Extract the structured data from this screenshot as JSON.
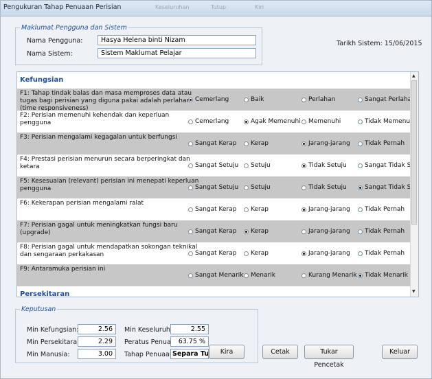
{
  "window": {
    "title": "Pengukuran Tahap Penuaan Perisian",
    "ghost_tabs": [
      "Keseluruhan",
      "Tutup",
      "Kiri"
    ]
  },
  "user_group": {
    "legend": "Maklumat Pengguna dan Sistem",
    "user_label": "Nama Pengguna:",
    "user_value": "Hasya Helena binti Nizam",
    "system_label": "Nama Sistem:",
    "system_value": "Sistem Maklumat Pelajar",
    "date_text": "Tarikh Sistem: 15/06/2015"
  },
  "panel": {
    "section1": "Kefungsian",
    "section2": "Persekitaran",
    "rows": [
      {
        "q": "F1: Tahap tindak balas dan masa memproses data atau tugas  bagi perisian yang diguna pakai adalah perlahan (time responsiveness)",
        "shade": true,
        "options": [
          "Cemerlang",
          "Baik",
          "Perlahan",
          "Sangat Perlahan"
        ],
        "selected": 0
      },
      {
        "q": "F2: Perisian  memenuhi kehendak dan keperluan pengguna",
        "shade": false,
        "options": [
          "Cemerlang",
          "Agak Memenuhi",
          "Memenuhi",
          "Tidak Memenuhi"
        ],
        "selected": 1
      },
      {
        "q": "F3: Perisian  mengalami kegagalan untuk berfungsi",
        "shade": true,
        "options": [
          "Sangat Kerap",
          "Kerap",
          "Jarang-jarang",
          "Tidak Pernah"
        ],
        "selected": 2
      },
      {
        "q": "F4: Prestasi perisian menurun secara berperingkat dan ketara",
        "shade": false,
        "options": [
          "Sangat Setuju",
          "Setuju",
          "Tidak Setuju",
          "Sangat Tidak Setuju"
        ],
        "selected": 2
      },
      {
        "q": "F5: Kesesuaian (relevant) perisian ini menepati keperluan pengguna",
        "shade": true,
        "options": [
          "Sangat Setuju",
          "Setuju",
          "Tidak Setuju",
          "Sangat Tidak Setuju"
        ],
        "selected": 3
      },
      {
        "q": "F6: Kekerapan perisian mengalami ralat",
        "shade": false,
        "options": [
          "Sangat Kerap",
          "Kerap",
          "Jarang-jarang",
          "Tidak Pernah"
        ],
        "selected": 2
      },
      {
        "q": "F7: Perisian gagal untuk meningkatkan fungsi baru (upgrade)",
        "shade": true,
        "options": [
          "Sangat Kerap",
          "Kerap",
          "Jarang-jarang",
          "Tidak Pernah"
        ],
        "selected": 1
      },
      {
        "q": "F8: Perisian gagal untuk mendapatkan sokongan teknikal dan sengaraan perkakasan",
        "shade": false,
        "options": [
          "Sangat Kerap",
          "Kerap",
          "Jarang-jarang",
          "Tidak Pernah"
        ],
        "selected": 2
      },
      {
        "q": "F9: Antaramuka perisian ini",
        "shade": true,
        "options": [
          "Sangat Menarik",
          "Menarik",
          "Kurang Menarik",
          "Tidak Menarik"
        ],
        "selected": 3
      }
    ]
  },
  "decision": {
    "legend": "Keputusan",
    "func_label": "Min Kefungsian:",
    "func_value": "2.56",
    "env_label": "Min Persekitaran:",
    "env_value": "2.29",
    "human_label": "Min Manusia:",
    "human_value": "3.00",
    "overall_label": "Min Keseluruhan:",
    "overall_value": "2.55",
    "percent_label": "Peratus Penuaan:",
    "percent_value": "63.75 %",
    "level_label": "Tahap Penuaan:",
    "level_value": "Separa Tua"
  },
  "buttons": {
    "kira": "Kira",
    "cetak": "Cetak",
    "tukar": "Tukar Pencetak",
    "keluar": "Keluar"
  }
}
